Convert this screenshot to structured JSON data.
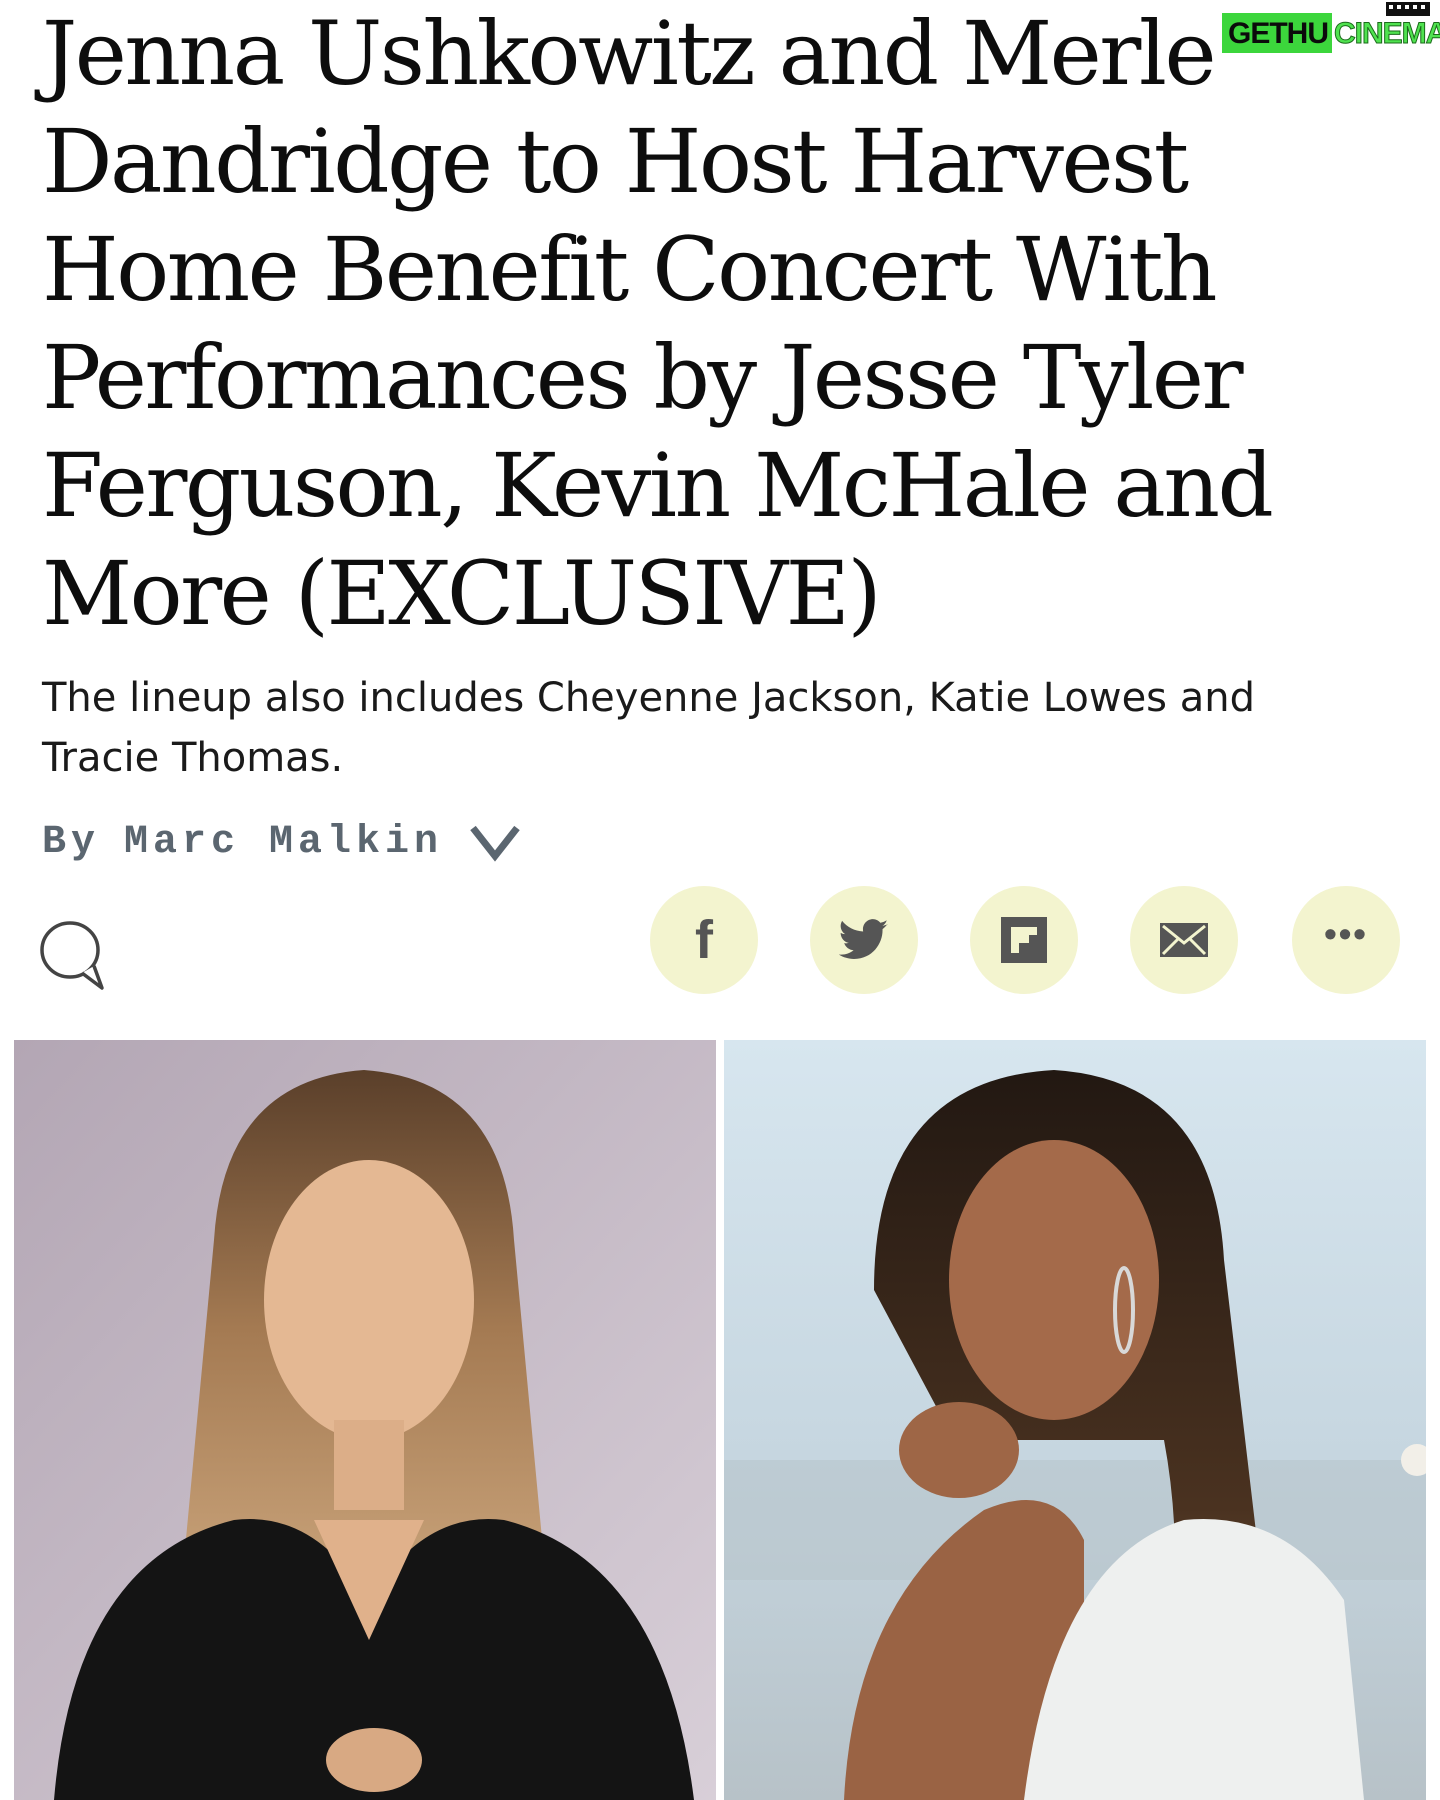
{
  "article": {
    "headline": "Jenna Ushkowitz and Merle Dandridge to Host Harvest Home Benefit Concert With Performances by Jesse Tyler Ferguson, Kevin McHale and More (EXCLUSIVE)",
    "subheadline": "The lineup also includes Cheyenne Jackson, Katie Lowes and Tracie Thomas.",
    "byline": {
      "prefix": "By",
      "author": "Marc Malkin"
    }
  },
  "watermark": {
    "part1": "GETHU",
    "part2": "CINEMA"
  },
  "actions": {
    "comment_icon": "speech-bubble-icon",
    "share_buttons": [
      {
        "name": "facebook",
        "icon": "facebook-icon"
      },
      {
        "name": "twitter",
        "icon": "twitter-bird-icon"
      },
      {
        "name": "flipboard",
        "icon": "flipboard-icon"
      },
      {
        "name": "email",
        "icon": "envelope-icon"
      },
      {
        "name": "more",
        "icon": "ellipsis-icon"
      }
    ]
  },
  "colors": {
    "share_bg": "#f3f4cf",
    "share_icon": "#555555",
    "byline": "#5b6670",
    "watermark_green": "#3cd63c"
  }
}
